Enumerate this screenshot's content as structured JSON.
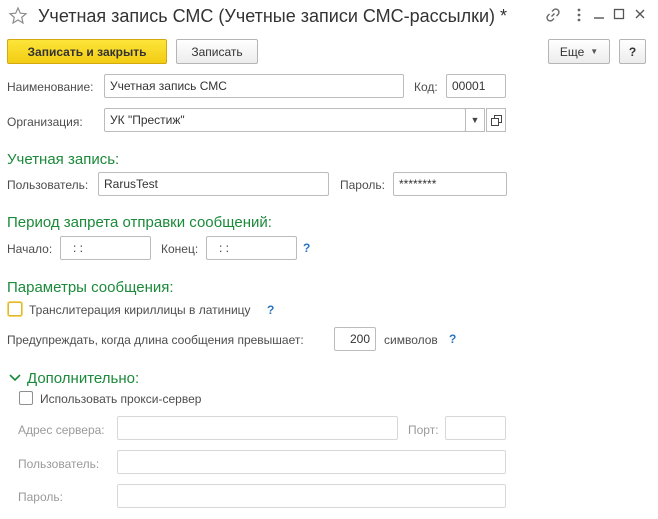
{
  "window": {
    "title": "Учетная запись СМС (Учетные записи СМС-рассылки) *"
  },
  "toolbar": {
    "save_close_label": "Записать и закрыть",
    "save_label": "Записать",
    "more_label": "Еще",
    "help_label": "?"
  },
  "main": {
    "name_label": "Наименование:",
    "name_value": "Учетная запись СМС",
    "code_label": "Код:",
    "code_value": "00001",
    "org_label": "Организация:",
    "org_value": "УК \"Престиж\""
  },
  "account": {
    "heading": "Учетная запись:",
    "user_label": "Пользователь:",
    "user_value": "RarusTest",
    "password_label": "Пароль:",
    "password_value": "********"
  },
  "period": {
    "heading": "Период запрета отправки сообщений:",
    "start_label": "Начало:",
    "start_value": ":  :",
    "end_label": "Конец:",
    "end_value": ":  :",
    "help": "?"
  },
  "message": {
    "heading": "Параметры сообщения:",
    "translit_label": "Транслитерация кириллицы в латиницу",
    "translit_checked": false,
    "translit_help": "?",
    "warn_label": "Предупреждать, когда длина сообщения превышает:",
    "warn_value": "200",
    "warn_unit": "символов",
    "warn_help": "?"
  },
  "extra": {
    "heading": "Дополнительно:",
    "proxy_label": "Использовать прокси-сервер",
    "proxy_checked": false,
    "server_label": "Адрес сервера:",
    "server_value": "",
    "port_label": "Порт:",
    "port_value": "",
    "user_label": "Пользователь:",
    "user_value": "",
    "password_label": "Пароль:",
    "password_value": ""
  },
  "colors": {
    "accent_green": "#1b8a3a",
    "primary_yellow": "#f2cc13",
    "help_blue": "#2b76c1"
  }
}
